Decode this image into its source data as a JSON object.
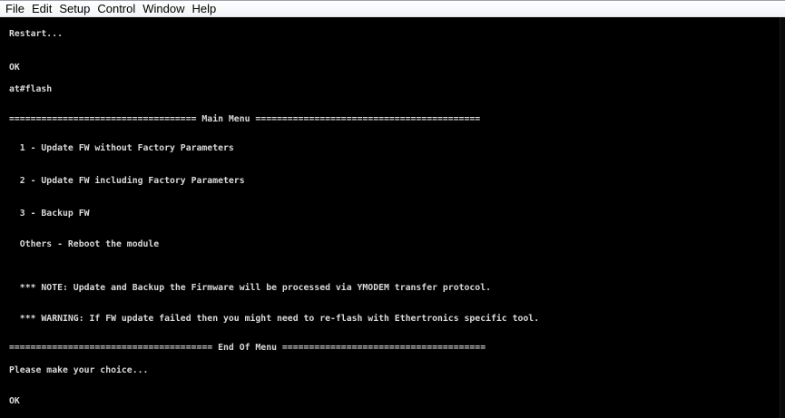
{
  "menubar": {
    "items": [
      "File",
      "Edit",
      "Setup",
      "Control",
      "Window",
      "Help"
    ]
  },
  "terminal": {
    "lines": {
      "restart": "Restart...",
      "ok_1": "OK",
      "command": "at#flash",
      "menu_header": "=================================== Main Menu ==========================================",
      "option_1": "  1 - Update FW without Factory Parameters",
      "option_2": "  2 - Update FW including Factory Parameters",
      "option_3": "  3 - Backup FW",
      "option_others": "  Others - Reboot the module",
      "note": "  *** NOTE: Update and Backup the Firmware will be processed via YMODEM transfer protocol.",
      "warning": "  *** WARNING: If FW update failed then you might need to re-flash with Ethertronics specific tool.",
      "menu_footer": "====================================== End Of Menu ======================================",
      "prompt": "Please make your choice...",
      "ok_2": "OK"
    },
    "colors": {
      "background": "#000000",
      "text": "#d9d9d9"
    }
  }
}
